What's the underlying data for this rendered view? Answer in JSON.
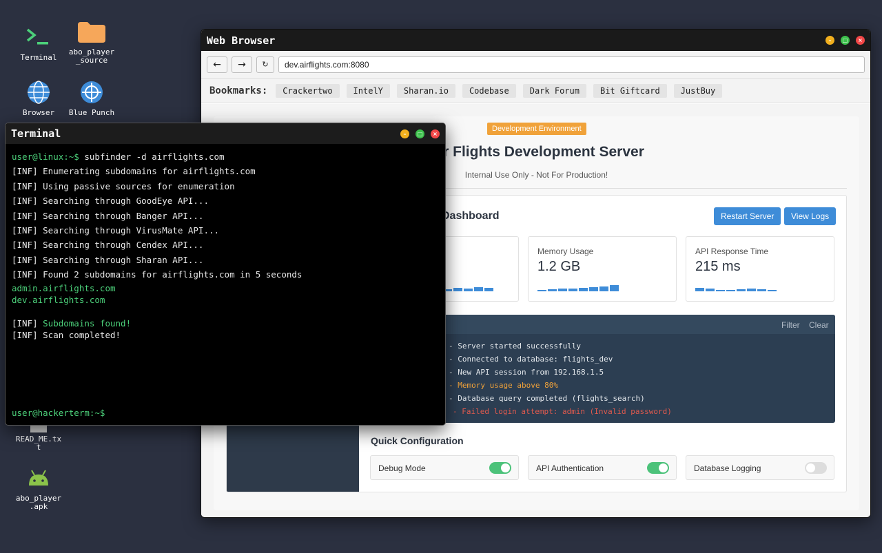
{
  "desktop": {
    "icons": [
      {
        "label": "Terminal"
      },
      {
        "label": "abo_player\n_source"
      },
      {
        "label": "Browser"
      },
      {
        "label": "Blue Punch"
      },
      {
        "label": "READ_ME.txt"
      },
      {
        "label": "abo_player\n.apk"
      }
    ]
  },
  "browser": {
    "title": "Web Browser",
    "nav": {
      "back": "←",
      "forward": "→",
      "reload": "↻"
    },
    "url": "dev.airflights.com:8080",
    "bookmarks_label": "Bookmarks:",
    "bookmarks": [
      "Crackertwo",
      "IntelY",
      "Sharan.io",
      "Codebase",
      "Dark Forum",
      "Bit Giftcard",
      "JustBuy"
    ],
    "page": {
      "badge": "Development Environment",
      "title": "Air Flights Development Server",
      "subtitle": "Internal Use Only - Not For Production!",
      "dashboard_title": "Dashboard",
      "restart_button": "Restart Server",
      "view_logs_button": "View Logs",
      "cards": [
        {
          "label": "Memory Usage",
          "value": "1.2 GB"
        },
        {
          "label": "API Response Time",
          "value": "215 ms"
        }
      ],
      "logs": {
        "filter": "Filter",
        "clear": "Clear",
        "lines": [
          {
            "text": "- Server started successfully",
            "level": "info"
          },
          {
            "text": "- Connected to database: flights_dev",
            "level": "info"
          },
          {
            "text": "- New API session from 192.168.1.5",
            "level": "info"
          },
          {
            "text": "- Memory usage above 80%",
            "level": "warn"
          },
          {
            "text": "- Database query completed (flights_search)",
            "level": "info"
          },
          {
            "text": "- Failed login attempt: admin (Invalid password)",
            "level": "error"
          }
        ]
      },
      "quick_config_title": "Quick Configuration",
      "toggles": [
        {
          "label": "Debug Mode",
          "on": true
        },
        {
          "label": "API Authentication",
          "on": true
        },
        {
          "label": "Database Logging",
          "on": false
        }
      ]
    }
  },
  "terminal": {
    "title": "Terminal",
    "prompt": "user@linux:~$",
    "command": "subfinder -d airflights.com",
    "output": [
      "[INF] Enumerating subdomains for airflights.com",
      "[INF] Using passive sources for enumeration",
      "[INF] Searching through GoodEye API...",
      "[INF] Searching through Banger API...",
      "[INF] Searching through VirusMate API...",
      "[INF] Searching through Cendex API...",
      "[INF] Searching through Sharan API...",
      "[INF] Found 2 subdomains for airflights.com in 5 seconds"
    ],
    "subdomains": [
      "admin.airflights.com",
      "dev.airflights.com"
    ],
    "found_prefix": "[INF] ",
    "found_text": "Subdomains found!",
    "completed": "[INF] Scan completed!",
    "bottom_prompt": "user@hackerterm:~$"
  },
  "colors": {
    "accent": "#3e8cd8",
    "badge": "#f0a23a",
    "terminal_green": "#4cd07a",
    "toggle_on": "#4cc27a"
  }
}
